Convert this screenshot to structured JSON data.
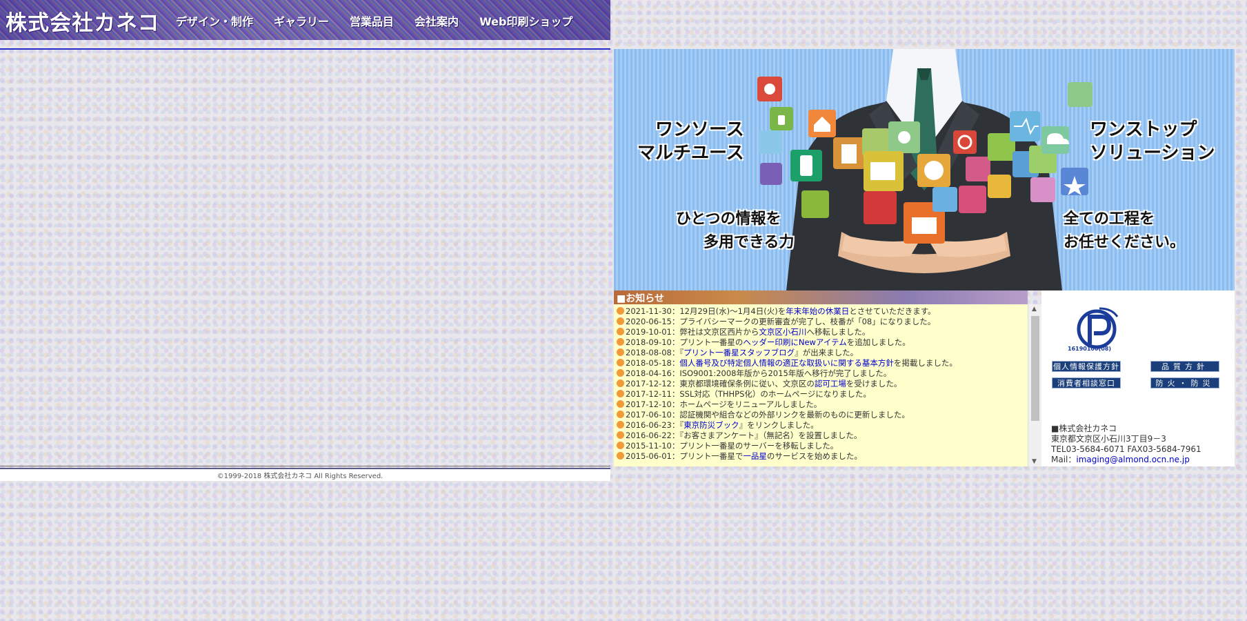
{
  "header": {
    "logo": "株式会社カネコ",
    "nav": [
      "デザイン・制作",
      "ギャラリー",
      "営業品目",
      "会社案内",
      "Web印刷ショップ"
    ]
  },
  "footer": {
    "copyright": "©1999-2018 株式会社カネコ All Rights Reserved."
  },
  "hero": {
    "left_title_1": "ワンソース",
    "left_title_2": "マルチユース",
    "left_sub_1": "ひとつの情報を",
    "left_sub_2": "多用できる力",
    "right_title_1": "ワンストップ",
    "right_title_2": "ソリューション",
    "right_sub_1": "全ての工程を",
    "right_sub_2": "お任せください。"
  },
  "news": {
    "title": "■お知らせ",
    "items": [
      {
        "date": "2021-11-30",
        "pre": "：12月29日(水)〜1月4日(火)を",
        "link": "年末年始の休業日",
        "post": "とさせていただきます。"
      },
      {
        "date": "2020-06-15",
        "pre": "：プライバシーマークの更新審査が完了し、枝番が「08」になりました。",
        "link": "",
        "post": ""
      },
      {
        "date": "2019-10-01",
        "pre": "：弊社は文京区西片から",
        "link": "文京区小石川",
        "post": "へ移転しました。"
      },
      {
        "date": "2018-09-10",
        "pre": "：プリント一番星の",
        "link": "ヘッダー印刷にNewアイテム",
        "post": "を追加しました。"
      },
      {
        "date": "2018-08-08",
        "pre": "：『",
        "link": "プリント一番星スタッフブログ",
        "post": "』が出来ました。"
      },
      {
        "date": "2018-05-18",
        "pre": "：",
        "link": "個人番号及び特定個人情報の適正な取扱いに関する基本方針",
        "post": "を掲載しました。"
      },
      {
        "date": "2018-04-16",
        "pre": "：ISO9001:2008年版から2015年版へ移行が完了しました。",
        "link": "",
        "post": ""
      },
      {
        "date": "2017-12-12",
        "pre": "：東京都環境確保条例に従い、文京区の",
        "link": "認可工場",
        "post": "を受けました。"
      },
      {
        "date": "2017-12-11",
        "pre": "：SSL対応（THHPS化）のホームページになりました。",
        "link": "",
        "post": ""
      },
      {
        "date": "2017-12-10",
        "pre": "：ホームページをリニューアルしました。",
        "link": "",
        "post": ""
      },
      {
        "date": "2017-06-10",
        "pre": "：認証機関や組合などの外部リンクを最新のものに更新しました。",
        "link": "",
        "post": ""
      },
      {
        "date": "2016-06-23",
        "pre": "：『",
        "link": "東京防災ブック",
        "post": "』をリンクしました。"
      },
      {
        "date": "2016-06-22",
        "pre": "：『お客さまアンケート』（無記名）を設置しました。",
        "link": "",
        "post": ""
      },
      {
        "date": "2015-11-10",
        "pre": "：プリント一番星のサーバーを移転しました。",
        "link": "",
        "post": ""
      },
      {
        "date": "2015-06-01",
        "pre": "：プリント一番星で",
        "link": "一品星",
        "post": "のサービスを始めました。"
      }
    ]
  },
  "info": {
    "privacy_number": "16190100(08)",
    "buttons": {
      "privacy_policy": "個人情報保護方針",
      "quality_policy": "品質方針",
      "consumer_desk": "消費者相談窓口",
      "fire_prevention": "防火・防災"
    },
    "company_name": "■株式会社カネコ",
    "address": "東京都文京区小石川3丁目9－3",
    "tel_fax": "TEL03-5684-6071 FAX03-5684-7961",
    "mail_label": "Mail：",
    "mail": "imaging@almond.ocn.ne.jp"
  },
  "icons": {
    "privacy_mark": "privacymark-icon",
    "news_bullet": "orange-dot-icon",
    "scroll_up": "scroll-up-arrow-icon",
    "scroll_down": "scroll-down-arrow-icon"
  },
  "colors": {
    "nav_rule": "#2a2ac8",
    "news_background": "#ffffcc",
    "link": "#0000cc",
    "bullet": "#f29a3a",
    "button": "#1b3f7a"
  }
}
